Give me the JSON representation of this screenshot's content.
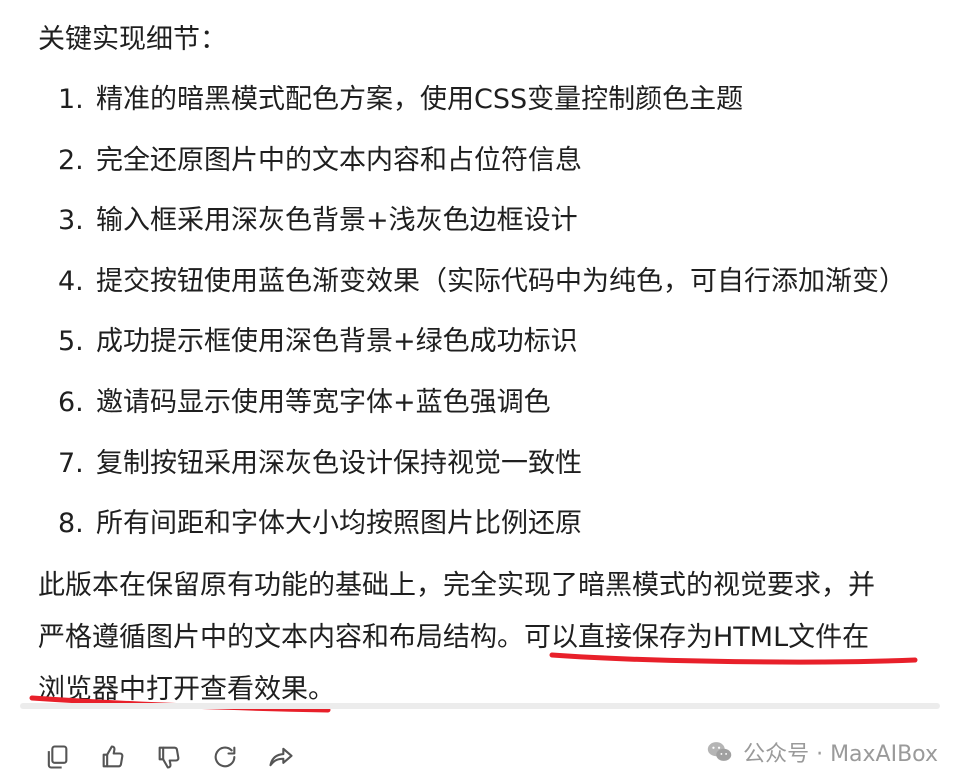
{
  "heading": "关键实现细节：",
  "list_items": [
    {
      "num": "1.",
      "text": "精准的暗黑模式配色方案，使用CSS变量控制颜色主题"
    },
    {
      "num": "2.",
      "text": "完全还原图片中的文本内容和占位符信息"
    },
    {
      "num": "3.",
      "text": "输入框采用深灰色背景+浅灰色边框设计"
    },
    {
      "num": "4.",
      "text": "提交按钮使用蓝色渐变效果（实际代码中为纯色，可自行添加渐变）"
    },
    {
      "num": "5.",
      "text": "成功提示框使用深色背景+绿色成功标识"
    },
    {
      "num": "6.",
      "text": "邀请码显示使用等宽字体+蓝色强调色"
    },
    {
      "num": "7.",
      "text": "复制按钮采用深灰色设计保持视觉一致性"
    },
    {
      "num": "8.",
      "text": "所有间距和字体大小均按照图片比例还原"
    }
  ],
  "paragraph": {
    "line1": "此版本在保留原有功能的基础上，完全实现了暗黑模式的视觉要求，并",
    "line2": "严格遵循图片中的文本内容和布局结构。可以直接保存为HTML文件在",
    "line3": "浏览器中打开查看效果。"
  },
  "toolbar": {
    "icons": [
      "copy-icon",
      "thumbs-up-icon",
      "thumbs-down-icon",
      "refresh-icon",
      "share-icon"
    ]
  },
  "watermark": {
    "text": "公众号 · MaxAIBox",
    "icon": "wechat-icon"
  },
  "colors": {
    "text": "#1f1f1f",
    "underline": "#e8202a",
    "icon": "#555555",
    "watermark": "#9a9a9a"
  }
}
